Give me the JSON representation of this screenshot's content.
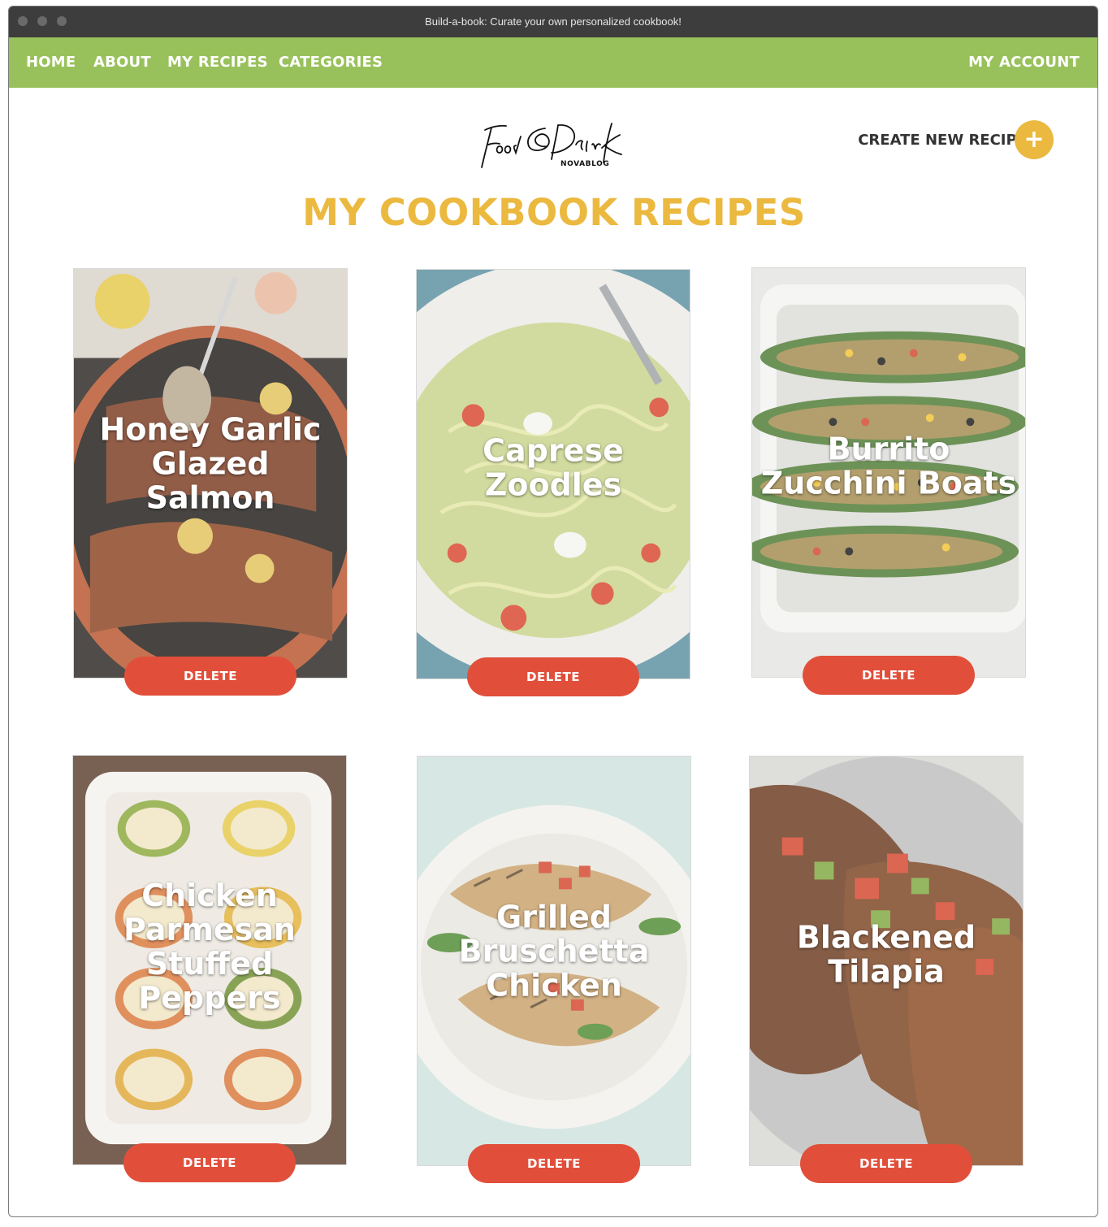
{
  "window": {
    "title": "Build-a-book: Curate your own personalized cookbook!"
  },
  "nav": {
    "items": [
      "HOME",
      "ABOUT",
      "MY RECIPES",
      "CATEGORIES"
    ],
    "account": "MY ACCOUNT"
  },
  "logo": {
    "script": "Food & Drink",
    "sub": "NOVABLOG"
  },
  "create": {
    "label": "CREATE NEW RECIPE",
    "icon": "+"
  },
  "page": {
    "title": "MY COOKBOOK RECIPES"
  },
  "recipes": [
    {
      "title": "Honey Garlic Glazed Salmon",
      "delete_label": "DELETE"
    },
    {
      "title": "Caprese Zoodles",
      "delete_label": "DELETE"
    },
    {
      "title": "Burrito Zucchini Boats",
      "delete_label": "DELETE"
    },
    {
      "title": "Chicken Parmesan Stuffed Peppers",
      "delete_label": "DELETE"
    },
    {
      "title": "Grilled Bruschetta Chicken",
      "delete_label": "DELETE"
    },
    {
      "title": "Blackened Tilapia",
      "delete_label": "DELETE"
    }
  ],
  "colors": {
    "nav_green": "#99c15b",
    "accent_yellow": "#ebb93f",
    "delete_red": "#e14f3b",
    "titlebar": "#3d3d3d"
  }
}
